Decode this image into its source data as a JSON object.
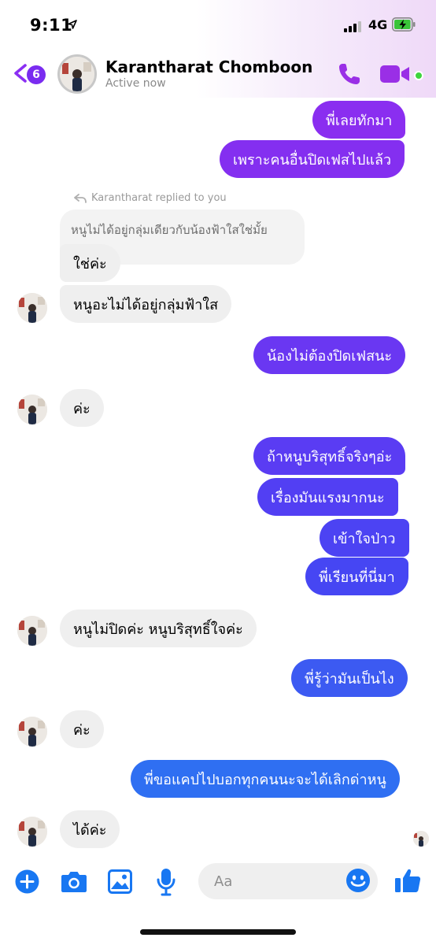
{
  "status_bar": {
    "time": "9:11",
    "network": "4G"
  },
  "header": {
    "unread_count": "6",
    "contact_name": "Karantharat Chomboon",
    "contact_status": "Active now"
  },
  "reply_context": {
    "label": "Karantharat replied to you",
    "quoted_text": "หนูไม่ได้อยู่กลุ่มเดียวกับน้องฟ้าใสใช่มั้ย"
  },
  "messages": [
    {
      "side": "out",
      "text": "พี่เลยทักมา"
    },
    {
      "side": "out",
      "text": "เพราะคนอื่นปิดเฟสไปแล้ว"
    },
    {
      "side": "in",
      "text": "ใช่ค่ะ"
    },
    {
      "side": "in",
      "text": "หนูอะไม่ได้อยู่กลุ่มฟ้าใส"
    },
    {
      "side": "out",
      "text": "น้องไม่ต้องปิดเฟสนะ"
    },
    {
      "side": "in",
      "text": "ค่ะ"
    },
    {
      "side": "out",
      "text": "ถ้าหนูบริสุทธิ์จริงๆอ่ะ"
    },
    {
      "side": "out",
      "text": "เรื่องมันแรงมากนะ"
    },
    {
      "side": "out",
      "text": "เข้าใจป่าว"
    },
    {
      "side": "out",
      "text": "พี่เรียนที่นี่มา"
    },
    {
      "side": "in",
      "text": "หนูไม่ปิดค่ะ หนูบริสุทธิ์ใจค่ะ"
    },
    {
      "side": "out",
      "text": "พี่รู้ว่ามันเป็นไง"
    },
    {
      "side": "in",
      "text": "ค่ะ"
    },
    {
      "side": "out",
      "text": "พี่ขอแคปไปบอกทุกคนนะจะได้เลิกด่าหนู"
    },
    {
      "side": "in",
      "text": "ได้ค่ะ"
    }
  ],
  "composer": {
    "placeholder": "Aa"
  },
  "icons": {
    "back": "chevron-left-icon",
    "phone": "phone-icon",
    "video": "video-camera-icon",
    "plus": "plus-icon",
    "camera": "camera-icon",
    "gallery": "image-icon",
    "mic": "microphone-icon",
    "emoji": "emoji-icon",
    "like": "thumbs-up-icon"
  },
  "colors": {
    "accent": "#7b2ff7",
    "outgoing_top": "#8a2ef0",
    "outgoing_bottom": "#2f6ff2",
    "online": "#3dd53d"
  }
}
